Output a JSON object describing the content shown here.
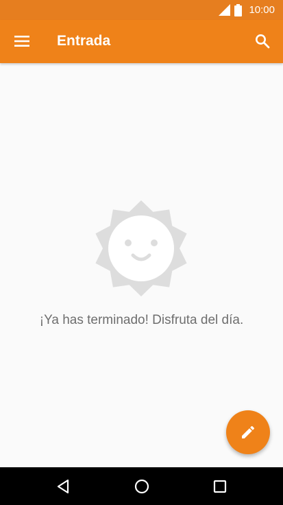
{
  "status_bar": {
    "time": "10:00",
    "icons": [
      "signal-icon",
      "battery-icon"
    ]
  },
  "app_bar": {
    "title": "Entrada",
    "left_icon": "menu-icon",
    "right_icon": "search-icon"
  },
  "empty_state": {
    "icon": "smiling-sun-icon",
    "message": "¡Ya has terminado! Disfruta del día."
  },
  "fab": {
    "icon": "pencil-icon"
  },
  "nav_bar": {
    "buttons": [
      "back-icon",
      "home-icon",
      "recents-icon"
    ]
  },
  "colors": {
    "accent": "#ef8219",
    "status_bar": "#e67e1f",
    "background": "#fafafa",
    "empty_icon": "#dddddd",
    "text_muted": "#6e6e6e",
    "nav_bar": "#000000"
  }
}
